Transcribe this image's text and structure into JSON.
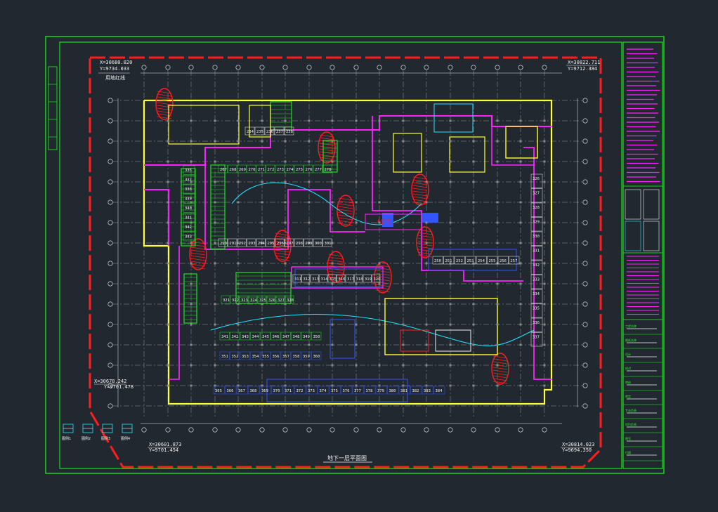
{
  "colors": {
    "background": "#212830",
    "frame": "#19ff19",
    "wall": "#ffff33",
    "magenta": "#ff22ff",
    "red": "#ff1e1e",
    "cyan": "#22e5ff",
    "blue": "#3355ff",
    "white": "#f0f0f0",
    "grid": "#c8c8c8",
    "green": "#22dd22",
    "grey": "#8a8a8a"
  },
  "corner_coords": {
    "top_left": {
      "x": "X=30680.820",
      "y": "Y=9734.033"
    },
    "top_right": {
      "x": "X=30822.711",
      "y": "Y=9712.384"
    },
    "bottom_left": {
      "x": "X=30678.242",
      "y": "Y=9701.478"
    },
    "bottom_mid": {
      "x": "X=30601.873",
      "y": "Y=9701.454"
    },
    "bottom_right": {
      "x": "X=30814.023",
      "y": "Y=9694.350"
    }
  },
  "stamp_label": "用地红线",
  "drawing_title": "地下一层平面图",
  "parking_rows": {
    "top_band": [
      "234",
      "235",
      "236",
      "237",
      "238"
    ],
    "upper_mid": [
      "267",
      "268",
      "269",
      "270",
      "271",
      "272",
      "273",
      "274",
      "275",
      "276",
      "277",
      "278"
    ],
    "mid_a": [
      "290",
      "291",
      "292",
      "293",
      "294",
      "295",
      "296",
      "297",
      "298",
      "299",
      "300",
      "301"
    ],
    "mid_b": [
      "311",
      "312",
      "313",
      "314",
      "315",
      "316",
      "317",
      "318",
      "319",
      "320"
    ],
    "mid_c": [
      "321",
      "322",
      "323",
      "324",
      "325",
      "326",
      "327",
      "328"
    ],
    "low_a": [
      "341",
      "342",
      "343",
      "344",
      "345",
      "346",
      "347",
      "348",
      "349",
      "350"
    ],
    "low_b": [
      "351",
      "352",
      "353",
      "354",
      "355",
      "356",
      "357",
      "358",
      "359",
      "360"
    ],
    "bottom_band": [
      "365",
      "366",
      "367",
      "368",
      "369",
      "370",
      "371",
      "372",
      "373",
      "374",
      "375",
      "376",
      "377",
      "378",
      "379",
      "380",
      "381",
      "382",
      "383",
      "384"
    ],
    "right_mid": [
      "250",
      "251",
      "252",
      "253",
      "254",
      "255",
      "256",
      "257"
    ],
    "right_col": [
      "326",
      "327",
      "328",
      "329",
      "330",
      "331",
      "332",
      "333",
      "334",
      "335",
      "336",
      "337"
    ],
    "left_col": [
      "336",
      "337",
      "338",
      "339",
      "340",
      "341",
      "342",
      "343"
    ]
  },
  "core_label": "人防门",
  "legend_items": [
    "图例1",
    "图例2",
    "图例3",
    "图例4"
  ],
  "title_block": {
    "rows": [
      "工程名称",
      "图纸名称",
      "设计",
      "校对",
      "审核",
      "审定",
      "专业负责",
      "项目负责",
      "图号",
      "日期"
    ]
  }
}
